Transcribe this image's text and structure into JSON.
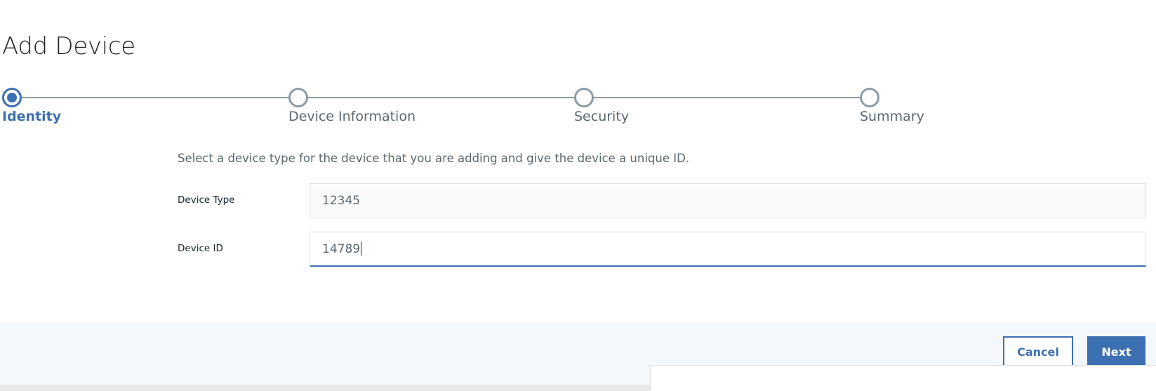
{
  "page": {
    "title": "Add Device"
  },
  "progress": {
    "steps": [
      {
        "label": "Identity",
        "state": "current"
      },
      {
        "label": "Device Information",
        "state": "incomplete"
      },
      {
        "label": "Security",
        "state": "incomplete"
      },
      {
        "label": "Summary",
        "state": "incomplete"
      }
    ]
  },
  "form": {
    "instructions": "Select a device type for the device that you are adding and give the device a unique ID.",
    "device_type": {
      "label": "Device Type",
      "value": "12345"
    },
    "device_id": {
      "label": "Device ID",
      "value": "14789"
    }
  },
  "footer": {
    "cancel_label": "Cancel",
    "next_label": "Next"
  },
  "colors": {
    "accent": "#3d70b2",
    "inactive": "#8c9ba5",
    "footer_bg": "#f4f7fb"
  }
}
